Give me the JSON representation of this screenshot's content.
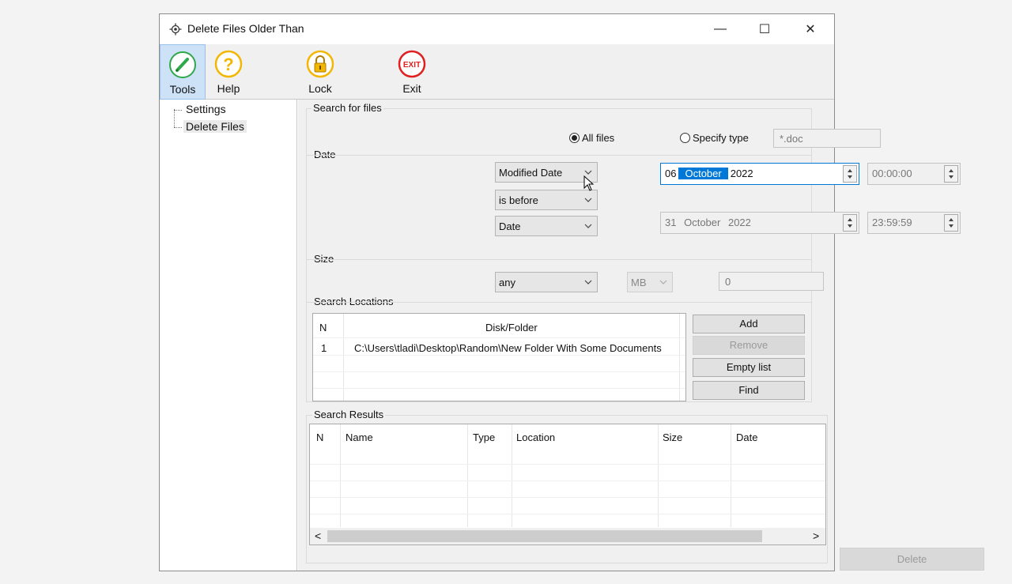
{
  "window": {
    "title": "Delete Files Older Than",
    "minimize": "—",
    "maximize": "☐",
    "close": "✕"
  },
  "toolbar": {
    "tools": "Tools",
    "help": "Help",
    "lock": "Lock",
    "exit": "Exit",
    "exit_badge": "EXIT"
  },
  "tree": {
    "items": [
      "Settings",
      "Delete Files"
    ],
    "selected": "Delete Files"
  },
  "search_for_files": {
    "label": "Search for files",
    "all_files": "All files",
    "specify_type": "Specify type",
    "type_placeholder": "*.doc",
    "selected": "All files"
  },
  "date": {
    "label": "Date",
    "field_combo": "Modified Date",
    "condition_combo": "is before",
    "mode_combo": "Date",
    "date1": {
      "day": "06",
      "month": "October",
      "year": "2022",
      "time": "00:00:00"
    },
    "date2": {
      "day": "31",
      "month": "October",
      "year": "2022",
      "time": "23:59:59"
    }
  },
  "size": {
    "label": "Size",
    "condition": "any",
    "unit": "MB",
    "value": "0"
  },
  "search_locations": {
    "label": "Search Locations",
    "columns": [
      "N",
      "Disk/Folder"
    ],
    "rows": [
      {
        "n": "1",
        "path": "C:\\Users\\tladi\\Desktop\\Random\\New Folder With Some Documents"
      }
    ],
    "buttons": {
      "add": "Add",
      "remove": "Remove",
      "empty": "Empty list",
      "find": "Find"
    }
  },
  "search_results": {
    "label": "Search Results",
    "columns": [
      "N",
      "Name",
      "Type",
      "Location",
      "Size",
      "Date"
    ],
    "scroll_left": "<",
    "scroll_right": ">",
    "delete": "Delete"
  },
  "colors": {
    "accent": "#0078d7",
    "tools_icon": "#2fa84a",
    "help_icon": "#f2b705",
    "exit_icon": "#e02020"
  }
}
